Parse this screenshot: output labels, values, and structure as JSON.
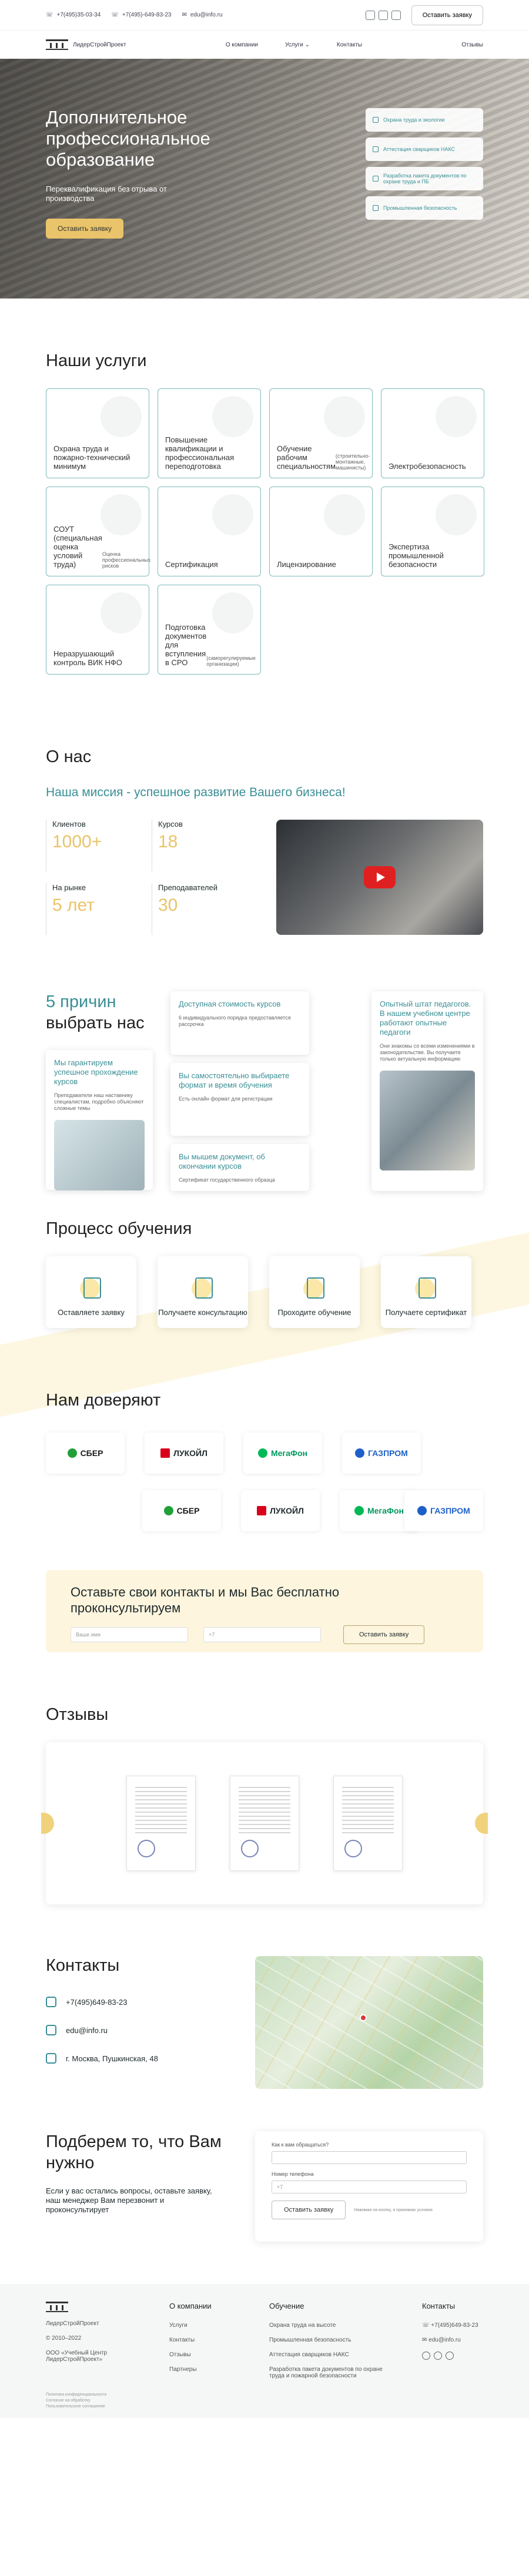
{
  "topbar": {
    "phone1": "+7(495)35-03-34",
    "phone2": "+7(495)-649-83-23",
    "email": "edu@info.ru",
    "cta": "Оставить заявку"
  },
  "nav": {
    "logo_text": "ЛидерСтройПроект",
    "items": [
      "О компании",
      "Услуги",
      "Контакты",
      "Отзывы"
    ]
  },
  "hero": {
    "title": "Дополнительное профессиональное образование",
    "subtitle": "Переквалификация без отрыва от производства",
    "cta": "Оставить заявку",
    "chips": [
      "Охрана труда и экологии",
      "Аттестация сварщиков НАКС",
      "Разработка пакета документов по охране труда и ПБ",
      "Промышленная безопасность"
    ]
  },
  "services": {
    "title": "Наши услуги",
    "items": [
      {
        "label": "Охрана труда и пожарно-технический минимум",
        "sub": ""
      },
      {
        "label": "Повышение квалификации и профессиональная переподготовка",
        "sub": ""
      },
      {
        "label": "Обучение рабочим специальностям",
        "sub": "(строительно-монтажные, машинисты)"
      },
      {
        "label": "Электробезопасность",
        "sub": ""
      },
      {
        "label": "",
        "sub": ""
      },
      {
        "label": "СОУТ (специальная оценка условий труда)",
        "sub": "Оценка профессиональных рисков"
      },
      {
        "label": "Сертификация",
        "sub": ""
      },
      {
        "label": "Лицензирование",
        "sub": ""
      },
      {
        "label": "Экспертиза промышленной безопасности",
        "sub": ""
      },
      {
        "label": "",
        "sub": ""
      },
      {
        "label": "Неразрушающий контроль ВИК НФО",
        "sub": ""
      },
      {
        "label": "Подготовка документов для вступления в СРО",
        "sub": "(саморегулируемые организации)"
      }
    ]
  },
  "about": {
    "title": "О нас",
    "mission": "Наша миссия - успешное развитие Вашего бизнеса!",
    "stats": [
      {
        "k": "Клиентов",
        "v": "1000+"
      },
      {
        "k": "Курсов",
        "v": "18"
      },
      {
        "k": "На рынке",
        "v": "5 лет"
      },
      {
        "k": "Преподавателей",
        "v": "30"
      }
    ]
  },
  "reasons": {
    "title_a": "5 причин",
    "title_b": "выбрать нас",
    "cards": [
      {
        "t": "Мы гарантируем успешное прохождение курсов",
        "d": "Преподаватели наш наставнику специалистам, подробно объясняют сложные темы"
      },
      {
        "t": "Доступная стоимость курсов",
        "d": "6 индивидуального порядка предоставляется рассрочка"
      },
      {
        "t": "Вы самостоятельно выбираете формат и время обучения",
        "d": "Есть онлайн формат для регистрации"
      },
      {
        "t": "Вы мышем документ, об окончании курсов",
        "d": "Сертификат государственного образца"
      },
      {
        "t": "Опытный штат педагогов. В нашем учебном центре работают опытные педагоги",
        "d": "Они знакомы со всеми изменениями в законодательстве. Вы получаете только актуальную информацию"
      }
    ]
  },
  "process": {
    "title": "Процесс обучения",
    "steps": [
      "Оставляете заявку",
      "Получаете консультацию",
      "Проходите обучение",
      "Получаете сертификат"
    ]
  },
  "trust": {
    "title": "Нам доверяют",
    "row1": [
      "СБЕР",
      "ЛУКОЙЛ",
      "МегаФон",
      "ГАЗПРОМ"
    ],
    "row2": [
      "СБЕР",
      "ЛУКОЙЛ",
      "МегаФон",
      "ГАЗПРОМ"
    ]
  },
  "cta": {
    "title": "Оставьте свои контакты и мы Вас бесплатно проконсультируем",
    "name_ph": "Ваше имя",
    "phone_ph": "+7",
    "button": "Оставить заявку"
  },
  "reviews": {
    "title": "Отзывы"
  },
  "contacts": {
    "title": "Контакты",
    "phone": "+7(495)649-83-23",
    "email": "edu@info.ru",
    "address": "г. Москва, Пушкинская, 48"
  },
  "match": {
    "title": "Подберем то, что Вам нужно",
    "text": "Если у вас остались вопросы, оставьте заявку, наш менеджер Вам перезвонит и проконсультирует",
    "q_label": "Как к вам обращаться?",
    "phone_label": "Номер телефона",
    "phone_ph": "+7",
    "button": "Оставить заявку",
    "note": "Нажимая на кнопку, я принимаю условия"
  },
  "footer": {
    "logo_text": "ЛидерСтройПроект",
    "copyright": "© 2010–2022",
    "org": "ООО «Учебный Центр ЛидерСтройПроект»",
    "about_title": "О компании",
    "about_items": [
      "Услуги",
      "Контакты",
      "Отзывы",
      "Партнеры"
    ],
    "edu_title": "Обучение",
    "edu_items": [
      "Охрана труда на высоте",
      "Промышленная безопасность",
      "Аттестация сварщиков НАКС",
      "Разработка пакета документов по охране труда и пожарной безопасности"
    ],
    "contacts_title": "Контакты",
    "phone": "+7(495)649-83-23",
    "email": "edu@info.ru",
    "legal": [
      "Политика конфиденциальности",
      "Согласие на обработку",
      "Пользовательское соглашение"
    ]
  }
}
